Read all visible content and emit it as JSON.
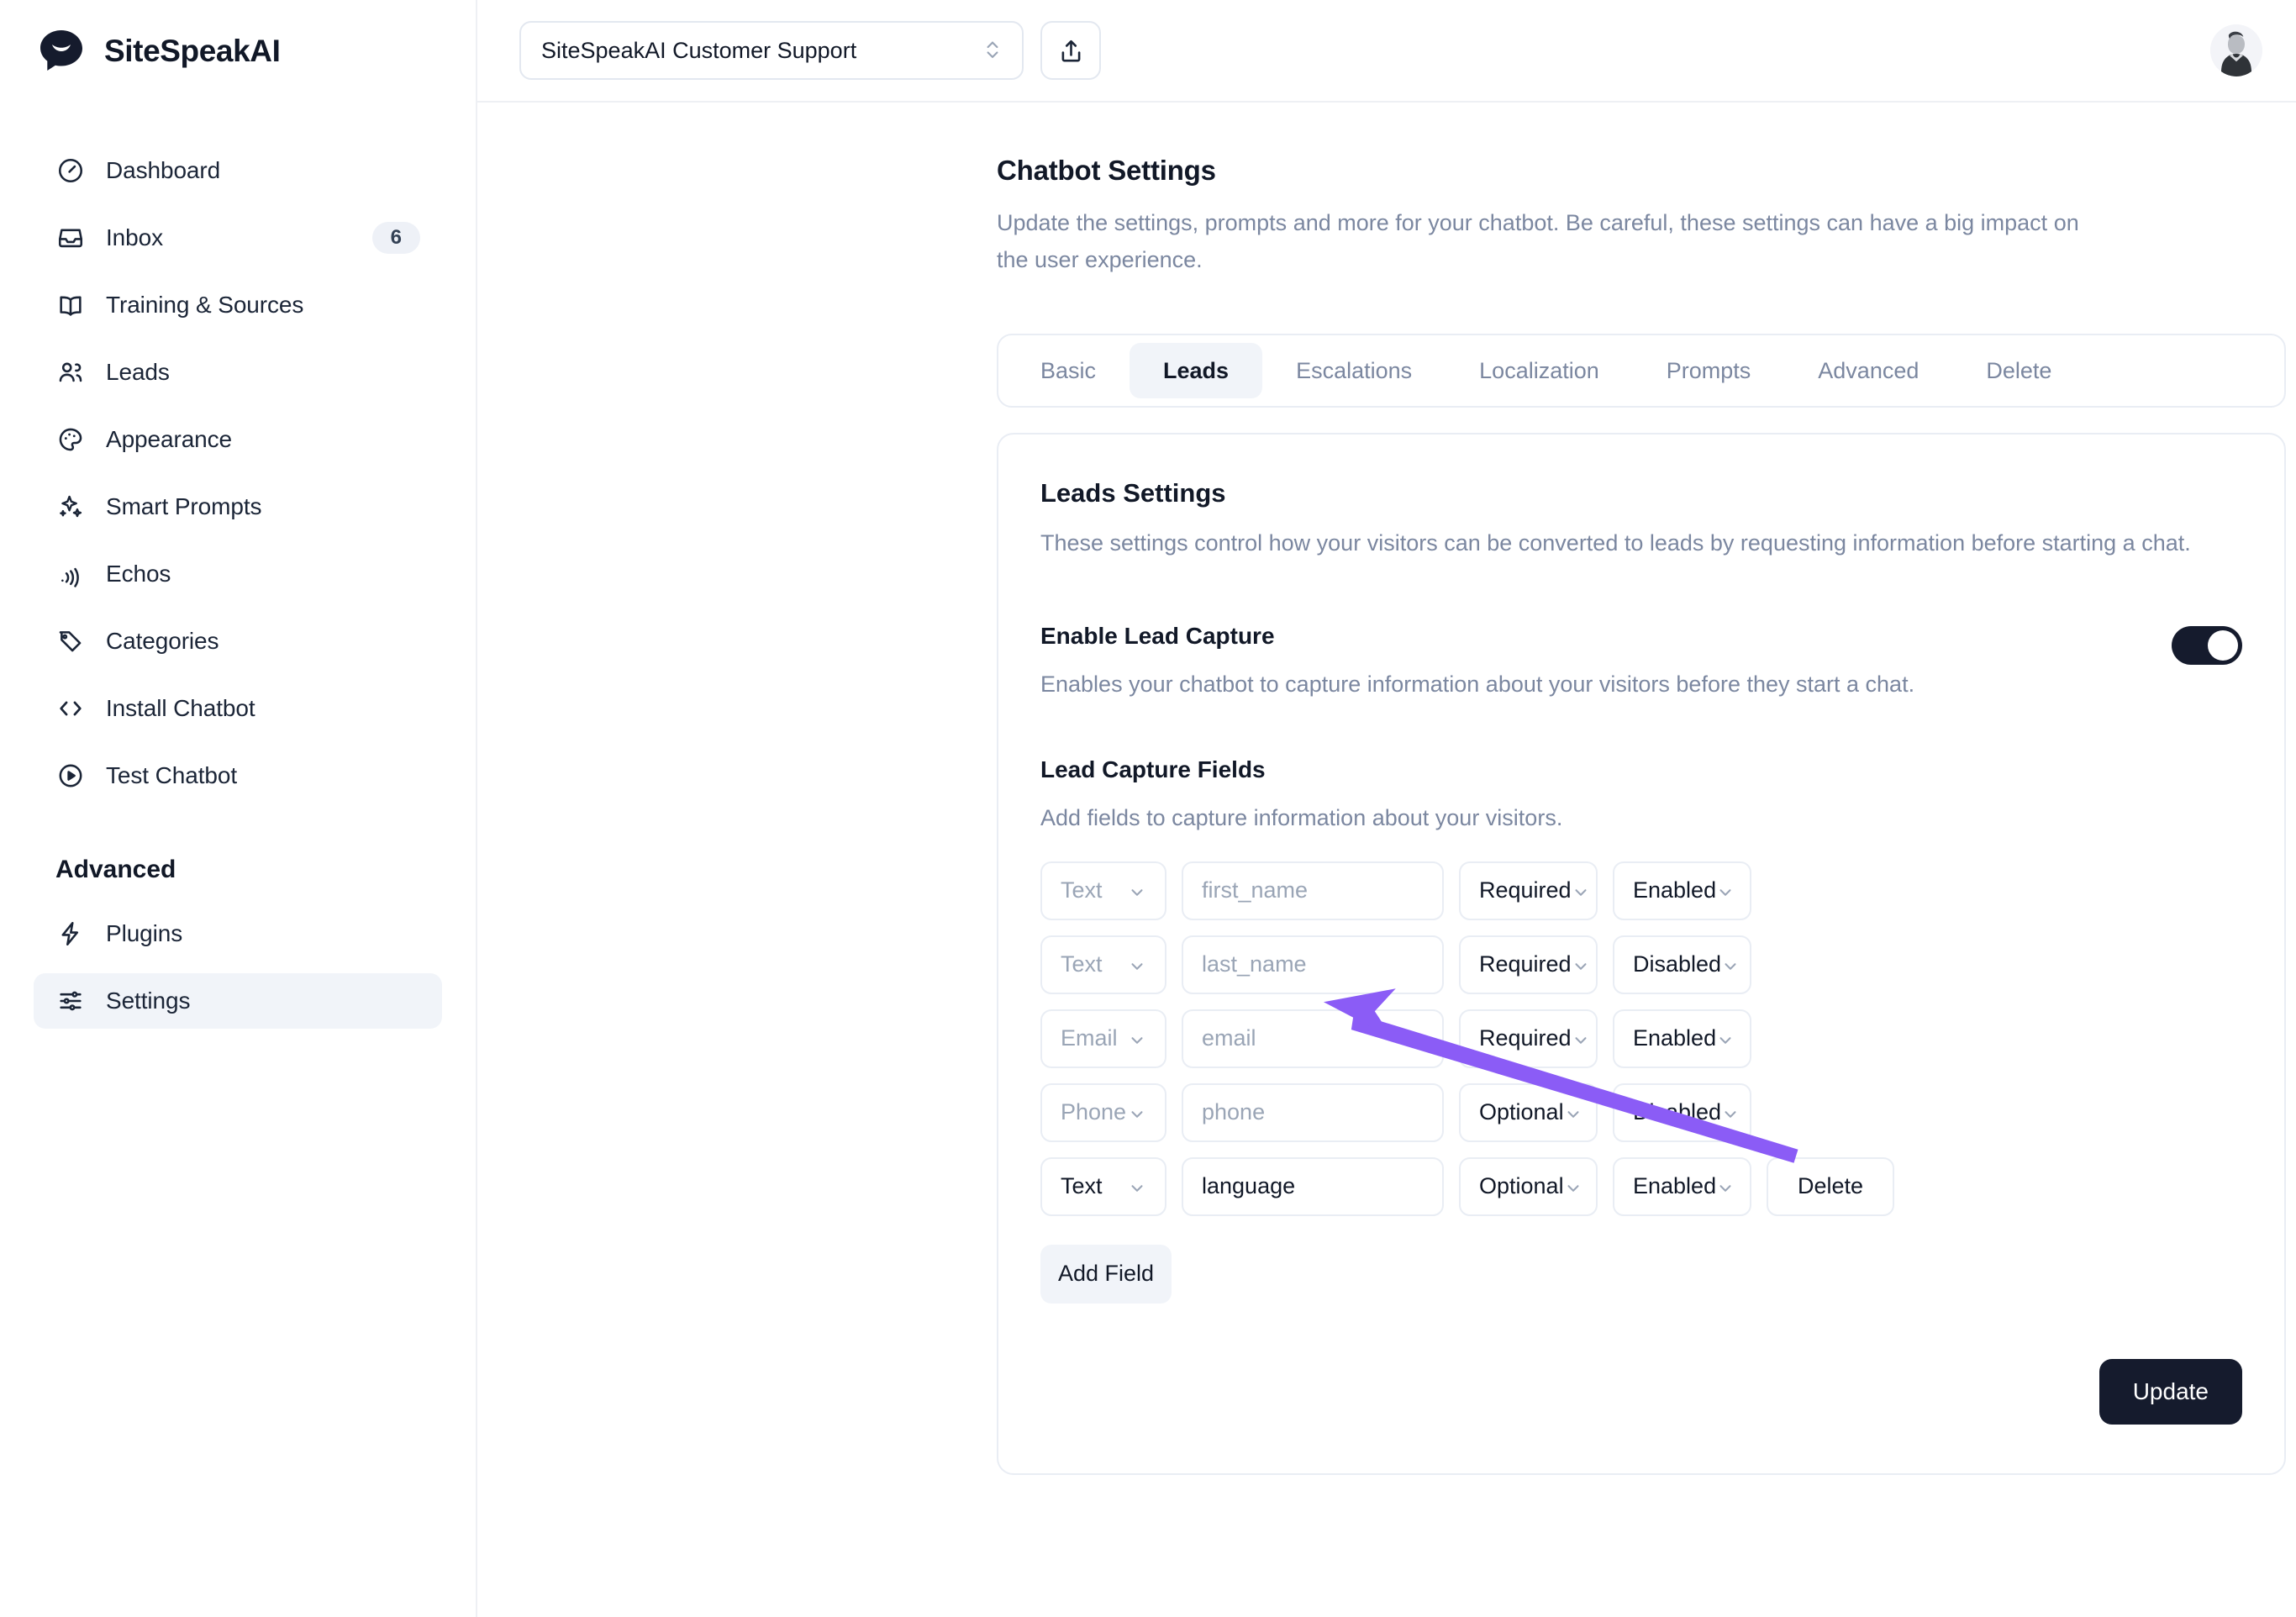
{
  "brand": {
    "name": "SiteSpeakAI",
    "logo_icon": "speech-bubble-logo"
  },
  "sidebar": {
    "items": [
      {
        "label": "Dashboard",
        "icon": "gauge-icon"
      },
      {
        "label": "Inbox",
        "icon": "inbox-icon",
        "badge": "6"
      },
      {
        "label": "Training & Sources",
        "icon": "book-icon"
      },
      {
        "label": "Leads",
        "icon": "users-icon"
      },
      {
        "label": "Appearance",
        "icon": "palette-icon"
      },
      {
        "label": "Smart Prompts",
        "icon": "sparkles-icon"
      },
      {
        "label": "Echos",
        "icon": "broadcast-icon"
      },
      {
        "label": "Categories",
        "icon": "tag-icon"
      },
      {
        "label": "Install Chatbot",
        "icon": "code-brackets-icon"
      },
      {
        "label": "Test Chatbot",
        "icon": "play-circle-icon"
      }
    ],
    "section_label": "Advanced",
    "advanced_items": [
      {
        "label": "Plugins",
        "icon": "bolt-icon",
        "active": false
      },
      {
        "label": "Settings",
        "icon": "sliders-icon",
        "active": true
      }
    ]
  },
  "topbar": {
    "chatbot_select_value": "SiteSpeakAI Customer Support",
    "chatbot_select_icon": "chevron-up-down-icon",
    "share_button_icon": "share-upload-icon",
    "avatar_icon": "user-avatar-photo"
  },
  "header": {
    "title": "Chatbot Settings",
    "description": "Update the settings, prompts and more for your chatbot. Be careful, these settings can have a big impact on the user experience."
  },
  "tabs": [
    {
      "label": "Basic",
      "active": false
    },
    {
      "label": "Leads",
      "active": true
    },
    {
      "label": "Escalations",
      "active": false
    },
    {
      "label": "Localization",
      "active": false
    },
    {
      "label": "Prompts",
      "active": false
    },
    {
      "label": "Advanced",
      "active": false
    },
    {
      "label": "Delete",
      "active": false
    }
  ],
  "leads_settings": {
    "title": "Leads Settings",
    "description": "These settings control how your visitors can be converted to leads by requesting information before starting a chat.",
    "enable_lead_capture": {
      "label": "Enable Lead Capture",
      "description": "Enables your chatbot to capture information about your visitors before they start a chat.",
      "enabled": true
    },
    "lead_capture_fields": {
      "title": "Lead Capture Fields",
      "description": "Add fields to capture information about your visitors.",
      "rows": [
        {
          "type": "Text",
          "name": "first_name",
          "requirement": "Required",
          "status": "Enabled",
          "locked": true,
          "delete_label": ""
        },
        {
          "type": "Text",
          "name": "last_name",
          "requirement": "Required",
          "status": "Disabled",
          "locked": true,
          "delete_label": ""
        },
        {
          "type": "Email",
          "name": "email",
          "requirement": "Required",
          "status": "Enabled",
          "locked": true,
          "delete_label": ""
        },
        {
          "type": "Phone",
          "name": "phone",
          "requirement": "Optional",
          "status": "Disabled",
          "locked": true,
          "delete_label": ""
        },
        {
          "type": "Text",
          "name": "language",
          "requirement": "Optional",
          "status": "Enabled",
          "locked": false,
          "delete_label": "Delete"
        }
      ],
      "add_field_label": "Add Field"
    },
    "update_label": "Update"
  },
  "annotation": {
    "arrow_color": "#8B5CF6",
    "points_to": "add-field-button"
  },
  "colors": {
    "accent": "#8B5CF6",
    "dark": "#151b2d",
    "muted_text": "#7b87a0",
    "border": "#e9edf4",
    "active_bg": "#f1f4f9"
  }
}
